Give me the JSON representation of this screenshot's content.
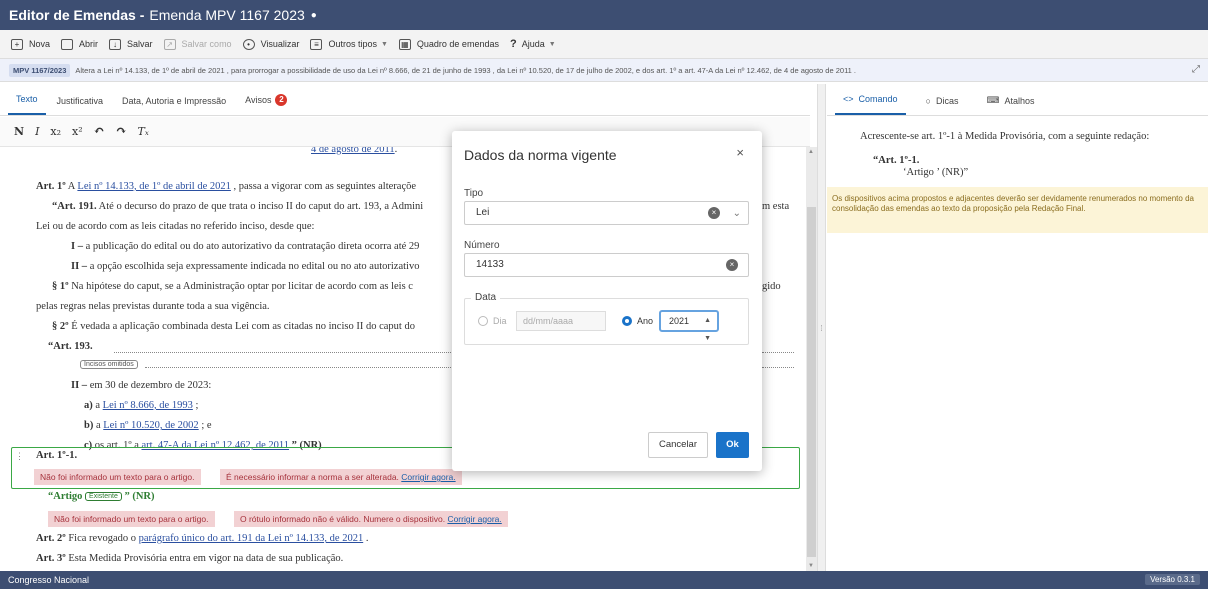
{
  "titlebar": {
    "app": "Editor de Emendas -",
    "doc": "Emenda MPV 1167 2023",
    "dirty": "●"
  },
  "toolbar": {
    "nova": "Nova",
    "abrir": "Abrir",
    "salvar": "Salvar",
    "salvar_como": "Salvar como",
    "visualizar": "Visualizar",
    "outros_tipos": "Outros tipos",
    "quadro": "Quadro de emendas",
    "ajuda": "Ajuda"
  },
  "infobar": {
    "tag": "MPV 1167/2023",
    "text": "Altera a Lei nº 14.133, de 1º de abril de 2021 , para prorrogar a possibilidade de uso da Lei nº 8.666, de 21 de junho de 1993 , da Lei nº 10.520, de 17 de julho de 2002, e dos art. 1º a art. 47-A da Lei nº 12.462, de 4 de agosto de 2011 ."
  },
  "tabs": {
    "texto": "Texto",
    "justificativa": "Justificativa",
    "data": "Data, Autoria e Impressão",
    "avisos": "Avisos",
    "avisos_count": "2"
  },
  "format": {
    "bold": "N",
    "italic": "I",
    "sub": "x₂",
    "sup": "x²",
    "undo": "↶",
    "redo": "↷",
    "clear": "Tₓ"
  },
  "editor": {
    "l0": "4 de agosto de 2011",
    "l1_art": "Art. 1º",
    "l1_a": "A",
    "l1_link": "Lei nº 14.133, de 1º de abril de 2021",
    "l1_rest": ", passa a vigorar com as seguintes alteraçõe",
    "l2_art": "“Art. 191.",
    "l2_text": "Até o decurso do prazo de que trata o inciso II do caput do art. 193, a Admini",
    "l2_tail": "m esta",
    "l3": "Lei ou de acordo com as leis citadas no referido inciso, desde que:",
    "l4_b": "I –",
    "l4": "a publicação do edital ou do ato autorizativo da contratação direta ocorra até 29",
    "l5_b": "II –",
    "l5": "a opção escolhida seja expressamente indicada no edital ou no ato autorizativo",
    "l6_b": "§ 1º",
    "l6": "Na hipótese do caput, se a Administração optar por licitar de acordo com as leis c",
    "l6_tail": "gido",
    "l7": "pelas regras nelas previstas durante toda a sua vigência.",
    "l8_b": "§ 2º",
    "l8": "É vedada a aplicação combinada desta Lei com as citadas no inciso II do caput do",
    "l9": "“Art. 193.",
    "l10_pill": "Incisos omitidos",
    "l11_b": "II –",
    "l11": "em 30 de dezembro de 2023:",
    "l12_b": "a)",
    "l12_a": "a",
    "l12_link": "Lei nº 8.666, de 1993",
    "l12_end": ";",
    "l13_b": "b)",
    "l13_a": "a",
    "l13_link": "Lei nº 10.520, de 2002",
    "l13_end": "; e",
    "l14_b": "c)",
    "l14_a": "os art. 1º a",
    "l14_link": "art. 47-A da Lei nº 12.462, de 2011",
    "l14_end": "” (NR)",
    "l15": "Art. 1º-1.",
    "err1a": "Não foi informado um texto para o artigo.",
    "err1b": "É necessário informar a norma a ser alterada.",
    "err1b_link": "Corrigir agora.",
    "l16_b": "“Artigo",
    "l16_pill": "Existente",
    "l16_end": "” (NR)",
    "err2a": "Não foi informado um texto para o artigo.",
    "err2b": "O rótulo informado não é válido. Numere o dispositivo.",
    "err2b_link": "Corrigir agora.",
    "l17_b": "Art. 2º",
    "l17_a": "Fica revogado o",
    "l17_link": "parágrafo único do art. 191 da Lei nº 14.133, de 2021",
    "l17_end": ".",
    "l18_b": "Art. 3º",
    "l18": "Esta Medida Provisória entra em vigor na data de sua publicação."
  },
  "modal": {
    "title": "Dados da norma vigente",
    "close": "×",
    "tipo_label": "Tipo",
    "tipo_value": "Lei",
    "numero_label": "Número",
    "numero_value": "14133",
    "data_legend": "Data",
    "dia_label": "Dia",
    "dia_placeholder": "dd/mm/aaaa",
    "ano_label": "Ano",
    "ano_value": "2021",
    "cancel": "Cancelar",
    "ok": "Ok"
  },
  "right": {
    "tab_comando": "Comando",
    "tab_dicas": "Dicas",
    "tab_atalhos": "Atalhos",
    "line1": "Acrescente-se art. 1º-1 à Medida Provisória, com a seguinte redação:",
    "line2": "“Art. 1º-1.",
    "line3": "‘Artigo ’ (NR)”",
    "note": "Os dispositivos acima propostos e adjacentes deverão ser devidamente renumerados no momento da consolidação das emendas ao texto da proposição pela Redação Final."
  },
  "statusbar": {
    "org": "Congresso Nacional",
    "version": "Versão 0.3.1"
  }
}
